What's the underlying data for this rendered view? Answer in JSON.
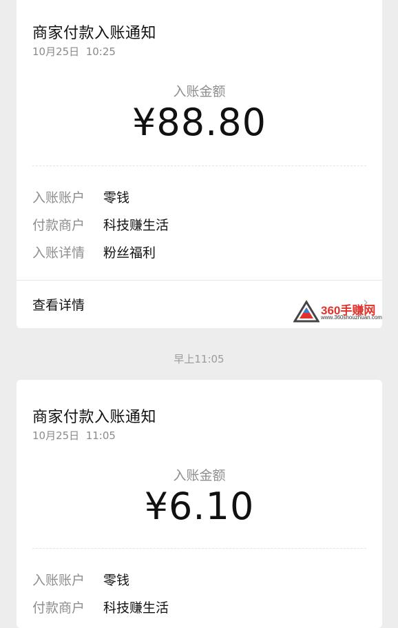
{
  "separator_time": "早上11:05",
  "cards": [
    {
      "title": "商家付款入账通知",
      "date": "10月25日  10:25",
      "amount_label": "入账金额",
      "amount": "¥88.80",
      "rows": [
        {
          "key": "入账账户",
          "value": "零钱"
        },
        {
          "key": "付款商户",
          "value": "科技赚生活"
        },
        {
          "key": "入账详情",
          "value": "粉丝福利"
        }
      ],
      "detail_link": "查看详情"
    },
    {
      "title": "商家付款入账通知",
      "date": "10月25日  11:05",
      "amount_label": "入账金额",
      "amount": "¥6.10",
      "rows": [
        {
          "key": "入账账户",
          "value": "零钱"
        },
        {
          "key": "付款商户",
          "value": "科技赚生活"
        }
      ]
    }
  ],
  "watermark": {
    "text": "360手赚网",
    "url": "www.360shouzhuan.com"
  }
}
